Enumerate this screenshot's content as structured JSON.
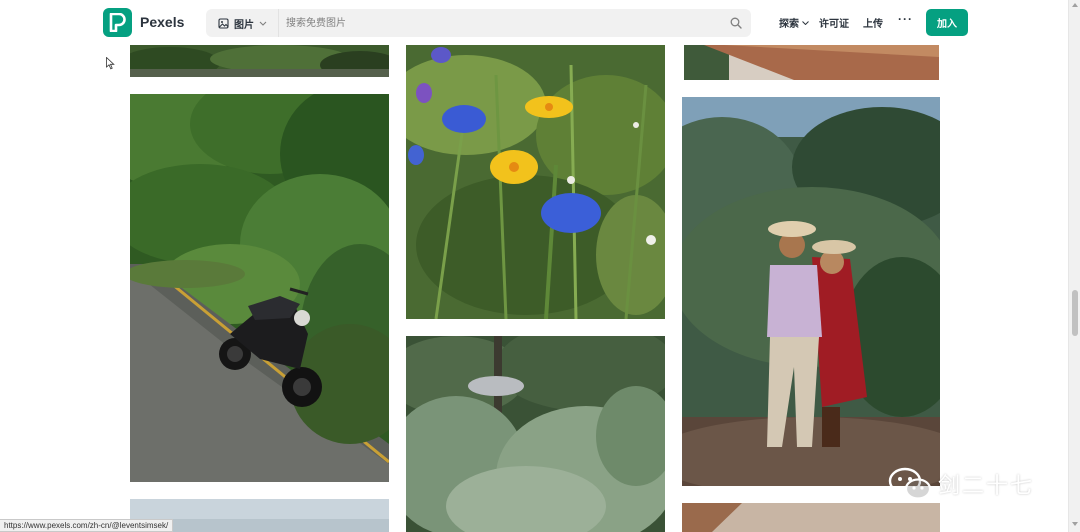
{
  "header": {
    "logo_text": "Pexels",
    "search": {
      "type_label": "图片",
      "placeholder": "搜索免费图片"
    },
    "nav": {
      "explore": "探索",
      "license": "许可证",
      "upload": "上传",
      "more": "···"
    },
    "join_label": "加入"
  },
  "colors": {
    "brand": "#05a081",
    "text": "#2c343e"
  },
  "photos": [
    {
      "name": "forest-top-crop",
      "subject": "forest"
    },
    {
      "name": "motorcycle-road",
      "subject": "motorcycle on road"
    },
    {
      "name": "road-bottom-crop",
      "subject": "sky"
    },
    {
      "name": "wildflowers",
      "subject": "wildflowers"
    },
    {
      "name": "pine-trees",
      "subject": "pine trees"
    },
    {
      "name": "wood-top-crop",
      "subject": "wood"
    },
    {
      "name": "couple-portrait",
      "subject": "couple"
    },
    {
      "name": "bottom-right-crop",
      "subject": "wood"
    }
  ],
  "statusbar": {
    "url": "https://www.pexels.com/zh-cn/@leventsimsek/"
  },
  "watermark": {
    "text": "剑二十七",
    "icon": "wechat-icon"
  }
}
